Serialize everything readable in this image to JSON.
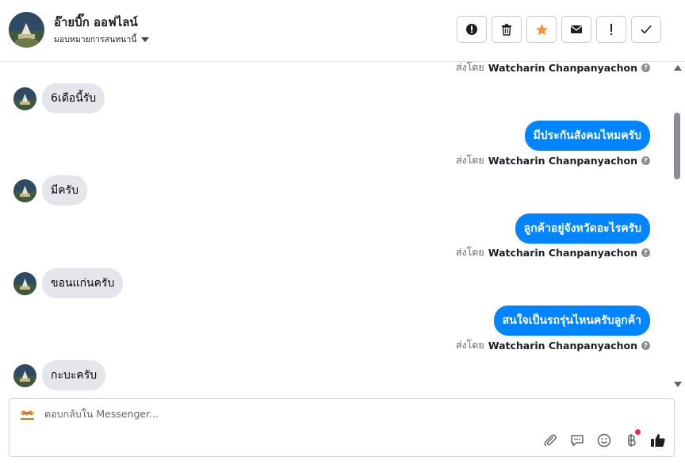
{
  "header": {
    "name": "อ๊ายบิ๊ก ออฟไลน์",
    "assign_label": "มอบหมายการสนทนานี้",
    "actions": [
      {
        "icon": "alert-circle-icon",
        "name": "mark-spam-button"
      },
      {
        "icon": "trash-icon",
        "name": "delete-button"
      },
      {
        "icon": "star-icon",
        "name": "star-button"
      },
      {
        "icon": "envelope-icon",
        "name": "mark-unread-button"
      },
      {
        "icon": "exclamation-icon",
        "name": "follow-up-button"
      },
      {
        "icon": "check-icon",
        "name": "done-button"
      }
    ]
  },
  "sent_by_label": "ส่งโดย",
  "agent_name": "Watcharin Chanpanyachon",
  "messages": [
    {
      "dir": "meta",
      "text": ""
    },
    {
      "dir": "in",
      "text": "6เดือนี้รับ"
    },
    {
      "dir": "out",
      "text": "มีประกันสังคมไหมครับ"
    },
    {
      "dir": "in",
      "text": "มีครับ"
    },
    {
      "dir": "out",
      "text": "ลูกค้าอยู่จังหวัดอะไรครับ"
    },
    {
      "dir": "in",
      "text": "ขอนแก่นครับ"
    },
    {
      "dir": "out",
      "text": "สนใจเป็นรถรุ่นไหนครับลูกค้า"
    },
    {
      "dir": "in",
      "text": "กะบะครับ"
    }
  ],
  "composer": {
    "placeholder": "ตอบกลับใน Messenger...",
    "tools": [
      "attachment-icon",
      "saved-reply-icon",
      "emoji-icon",
      "baht-payment-icon",
      "like-icon"
    ]
  },
  "colors": {
    "outgoing_bubble": "#0084ff",
    "incoming_bubble": "#e4e6eb",
    "star": "#f7923a",
    "notification_dot": "#f02849"
  }
}
